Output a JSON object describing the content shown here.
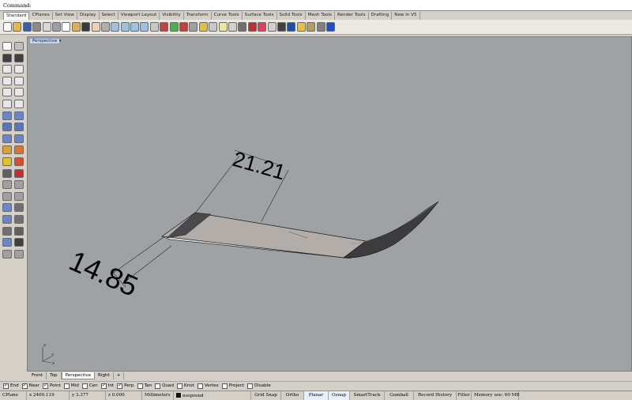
{
  "command": {
    "label": "Command:"
  },
  "tabs": [
    {
      "label": "Standard",
      "active": true
    },
    {
      "label": "CPlanes"
    },
    {
      "label": "Set View"
    },
    {
      "label": "Display"
    },
    {
      "label": "Select"
    },
    {
      "label": "Viewport Layout"
    },
    {
      "label": "Visibility"
    },
    {
      "label": "Transform"
    },
    {
      "label": "Curve Tools"
    },
    {
      "label": "Surface Tools"
    },
    {
      "label": "Solid Tools"
    },
    {
      "label": "Mesh Tools"
    },
    {
      "label": "Render Tools"
    },
    {
      "label": "Drafting"
    },
    {
      "label": "New in V5"
    }
  ],
  "toolbar_icons": [
    {
      "name": "new-file-icon",
      "color": "#ffffff"
    },
    {
      "name": "open-folder-icon",
      "color": "#e8b840"
    },
    {
      "name": "save-icon",
      "color": "#3a5fa8"
    },
    {
      "name": "print-icon",
      "color": "#8a8a8a"
    },
    {
      "name": "import-icon",
      "color": "#d8d8d8"
    },
    {
      "name": "cut-icon",
      "color": "#9aa0a8"
    },
    {
      "name": "copy-icon",
      "color": "#ffffff"
    },
    {
      "name": "paste-icon",
      "color": "#d8b060"
    },
    {
      "name": "undo-icon",
      "color": "#3a3a3a"
    },
    {
      "name": "pan-hand-icon",
      "color": "#f0d0b0"
    },
    {
      "name": "rotate-view-icon",
      "color": "#b0b0b0"
    },
    {
      "name": "zoom-icon",
      "color": "#a0c0e0"
    },
    {
      "name": "zoom-window-icon",
      "color": "#a0c0e0"
    },
    {
      "name": "zoom-extents-icon",
      "color": "#a0c0e0"
    },
    {
      "name": "zoom-selected-icon",
      "color": "#a0c0e0"
    },
    {
      "name": "four-view-icon",
      "color": "#c8c8c8"
    },
    {
      "name": "grid-icon",
      "color": "#c84040"
    },
    {
      "name": "point-icon",
      "color": "#50b050"
    },
    {
      "name": "move-cplane-icon",
      "color": "#c04040"
    },
    {
      "name": "cplane-icon",
      "color": "#a0a0a0"
    },
    {
      "name": "named-view-icon",
      "color": "#e0c040"
    },
    {
      "name": "properties-icon",
      "color": "#c8c8c8"
    },
    {
      "name": "light-bulb-icon",
      "color": "#e8e8a0"
    },
    {
      "name": "layer-icon",
      "color": "#d0d0d0"
    },
    {
      "name": "lock-icon",
      "color": "#707070"
    },
    {
      "name": "shade-icon",
      "color": "#c03030"
    },
    {
      "name": "color-wheel-icon",
      "color": "#e04060"
    },
    {
      "name": "sphere-render-icon",
      "color": "#d0d0d0"
    },
    {
      "name": "material-icon",
      "color": "#404040"
    },
    {
      "name": "render-icon",
      "color": "#2050a0"
    },
    {
      "name": "options-icon",
      "color": "#e8c040"
    },
    {
      "name": "settings-icon",
      "color": "#b0a060"
    },
    {
      "name": "tools-icon",
      "color": "#808080"
    },
    {
      "name": "help-icon",
      "color": "#2050c0"
    }
  ],
  "left_tools": [
    {
      "name": "select-arrow-icon",
      "color": "#ffffff"
    },
    {
      "name": "point-cloud-icon",
      "color": "#c0c0c0"
    },
    {
      "name": "polyline-icon",
      "color": "#404040"
    },
    {
      "name": "curve-icon",
      "color": "#404040"
    },
    {
      "name": "circle-icon",
      "color": "#e8e8e8"
    },
    {
      "name": "arc-icon",
      "color": "#e8e8e8"
    },
    {
      "name": "ellipse-icon",
      "color": "#e8e8e8"
    },
    {
      "name": "rectangle-icon",
      "color": "#e8e8e8"
    },
    {
      "name": "polygon-icon",
      "color": "#e8e8e8"
    },
    {
      "name": "free-curve-icon",
      "color": "#e8e8e8"
    },
    {
      "name": "offset-curve-icon",
      "color": "#e8e8e8"
    },
    {
      "name": "fillet-curve-icon",
      "color": "#e8e8e8"
    },
    {
      "name": "surface-icon",
      "color": "#6a86c8"
    },
    {
      "name": "loft-icon",
      "color": "#6a86c8"
    },
    {
      "name": "box-icon",
      "color": "#5a76b8"
    },
    {
      "name": "sphere-icon",
      "color": "#5a76b8"
    },
    {
      "name": "cylinder-icon",
      "color": "#6a86c8"
    },
    {
      "name": "extrude-icon",
      "color": "#6a86c8"
    },
    {
      "name": "boolean-icon",
      "color": "#e0a030"
    },
    {
      "name": "split-icon",
      "color": "#e07030"
    },
    {
      "name": "explode-icon",
      "color": "#e0c030"
    },
    {
      "name": "trim-icon",
      "color": "#d05030"
    },
    {
      "name": "join-icon",
      "color": "#606060"
    },
    {
      "name": "group-icon",
      "color": "#c03030"
    },
    {
      "name": "move-icon",
      "color": "#a0a0a0"
    },
    {
      "name": "rotate-icon",
      "color": "#a0a0a0"
    },
    {
      "name": "scale-icon",
      "color": "#a0a0a0"
    },
    {
      "name": "mirror-icon",
      "color": "#a0a0a0"
    },
    {
      "name": "array-icon",
      "color": "#6a86c8"
    },
    {
      "name": "dimension-icon",
      "color": "#707070"
    },
    {
      "name": "mesh-icon",
      "color": "#6a86c8"
    },
    {
      "name": "text-icon",
      "color": "#707070"
    },
    {
      "name": "grid-snap-icon",
      "color": "#707070"
    },
    {
      "name": "analyze-icon",
      "color": "#606060"
    },
    {
      "name": "curvature-icon",
      "color": "#6a86c8"
    },
    {
      "name": "check-icon",
      "color": "#404040"
    },
    {
      "name": "render-mesh-icon",
      "color": "#a0a0a0"
    },
    {
      "name": "history-icon",
      "color": "#a0a0a0"
    }
  ],
  "viewport": {
    "label": "Perspective",
    "menu_glyph": "▾",
    "background": "#9ea2a5",
    "dimensions": [
      "21.21",
      "14.85"
    ],
    "axes": {
      "x": "x",
      "y": "y",
      "z": "z"
    }
  },
  "viewport_tabs": [
    {
      "label": "Front"
    },
    {
      "label": "Top"
    },
    {
      "label": "Perspective",
      "active": true
    },
    {
      "label": "Right"
    },
    {
      "label": "+"
    }
  ],
  "osnaps": [
    {
      "label": "End",
      "checked": true
    },
    {
      "label": "Near",
      "checked": true
    },
    {
      "label": "Point",
      "checked": true
    },
    {
      "label": "Mid",
      "checked": false
    },
    {
      "label": "Cen",
      "checked": false
    },
    {
      "label": "Int",
      "checked": true
    },
    {
      "label": "Perp",
      "checked": true
    },
    {
      "label": "Tan",
      "checked": false
    },
    {
      "label": "Quad",
      "checked": false
    },
    {
      "label": "Knot",
      "checked": false
    },
    {
      "label": "Vertex",
      "checked": false
    },
    {
      "label": "Project",
      "checked": false
    },
    {
      "label": "Disable",
      "checked": false
    }
  ],
  "status": {
    "cplane": "CPlane",
    "x": "x 2400.119",
    "y": "y 3.377",
    "z": "z 0.000",
    "units": "Millimeters",
    "layer": "nosprend",
    "panes": [
      {
        "label": "Grid Snap",
        "on": false
      },
      {
        "label": "Ortho",
        "on": false
      },
      {
        "label": "Planar",
        "on": true
      },
      {
        "label": "Osnap",
        "on": true
      },
      {
        "label": "SmartTrack",
        "on": false
      },
      {
        "label": "Gumball",
        "on": false
      },
      {
        "label": "Record History",
        "on": false
      },
      {
        "label": "Filter",
        "on": false
      }
    ],
    "memory": "Memory use: 60 MB"
  }
}
